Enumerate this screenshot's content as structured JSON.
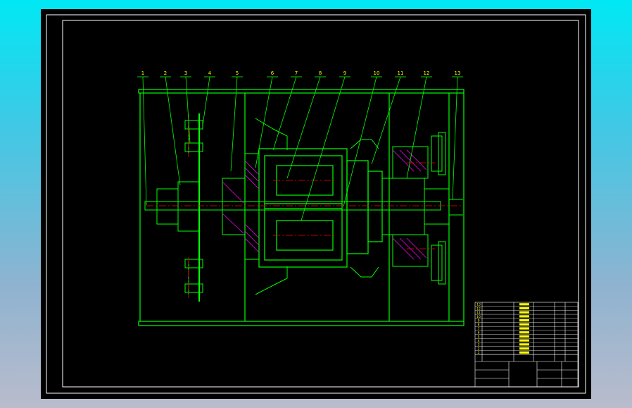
{
  "colors": {
    "outer_background": "#00e8f4",
    "sheet_background": "#000000",
    "frame": "#ffffff",
    "geometry": "#00ff00",
    "centerline": "#ff0000",
    "hatch": "#ff00ff",
    "annotation": "#ffff00",
    "hidden": "#00ffff"
  },
  "drawing": {
    "leader_labels": [
      "1",
      "2",
      "3",
      "4",
      "5",
      "6",
      "7",
      "8",
      "9",
      "10",
      "11",
      "12",
      "13"
    ]
  },
  "title_block": {
    "parts_rows": [
      "13",
      "12",
      "11",
      "10",
      "9",
      "8",
      "7",
      "6",
      "5",
      "4",
      "3",
      "2",
      "1"
    ]
  }
}
